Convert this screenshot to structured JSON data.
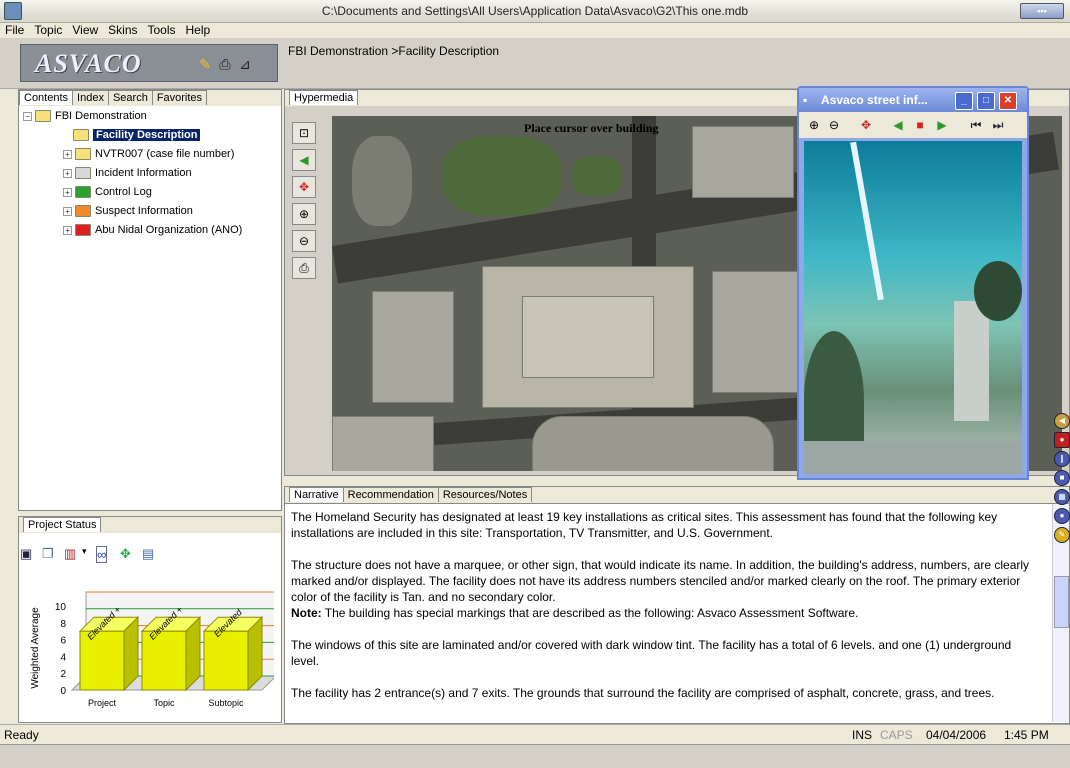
{
  "window": {
    "title": "C:\\Documents and Settings\\All Users\\Application Data\\Asvaco\\G2\\This one.mdb"
  },
  "menu": [
    "File",
    "Topic",
    "View",
    "Skins",
    "Tools",
    "Help"
  ],
  "logo": "ASVACO",
  "breadcrumb": "FBI Demonstration >Facility Description",
  "left_tabs": [
    "Contents",
    "Index",
    "Search",
    "Favorites"
  ],
  "tree": {
    "root": "FBI Demonstration",
    "items": [
      {
        "label": "Facility Description",
        "color": "#f5e07a",
        "selected": true
      },
      {
        "label": "NVTR007 (case file number)",
        "color": "#f5e07a"
      },
      {
        "label": "Incident Information",
        "color": "#d8d8d8"
      },
      {
        "label": "Control Log",
        "color": "#2ea02e"
      },
      {
        "label": "Suspect Information",
        "color": "#f08a2a"
      },
      {
        "label": "Abu Nidal Organization (ANO)",
        "color": "#e02020"
      }
    ]
  },
  "hyper_tab": "Hypermedia",
  "map_label": "Place cursor over building",
  "popup": {
    "title": "Asvaco street inf..."
  },
  "narr_tabs": [
    "Narrative",
    "Recommendation",
    "Resources/Notes"
  ],
  "narrative": {
    "p1": "The Homeland Security has designated at least 19 key installations as critical sites.  This assessment has found that the following key installations are included in this site: Transportation, TV Transmitter, and U.S. Government.",
    "p2": "The structure does not have a marquee, or other sign,  that would indicate its name.  In addition, the building's address, numbers,  are clearly marked and/or displayed.  The facility does not have its address numbers stenciled and/or marked clearly on the roof.  The primary exterior color of the facility is Tan.  and no secondary color.",
    "note_label": "Note:",
    "note": "  The building has special markings that are described as the following:  Asvaco Assessment Software.",
    "p3": "The windows of this site are laminated and/or covered with dark window tint.  The facility has a total of 6 levels.  and one (1) underground level.",
    "p4": "The facility has 2 entrance(s) and 7 exits.  The grounds that surround the facility are comprised of asphalt, concrete, grass, and trees."
  },
  "project_status": {
    "tab": "Project Status"
  },
  "chart_data": {
    "type": "bar",
    "title": "",
    "ylabel": "Weighted Average",
    "xlabel": "",
    "categories": [
      "Project",
      "Topic",
      "Subtopic"
    ],
    "values": [
      7,
      7,
      7
    ],
    "bar_labels": [
      "Elevated +",
      "Elevated +",
      "Elevated"
    ],
    "yticks": [
      "0",
      "2",
      "4",
      "6",
      "8",
      "10"
    ],
    "ylim": [
      0,
      10
    ],
    "bar_color": "#e8f000"
  },
  "status": {
    "left": "Ready",
    "ins": "INS",
    "caps": "CAPS",
    "date": "04/04/2006",
    "time": "1:45 PM"
  }
}
